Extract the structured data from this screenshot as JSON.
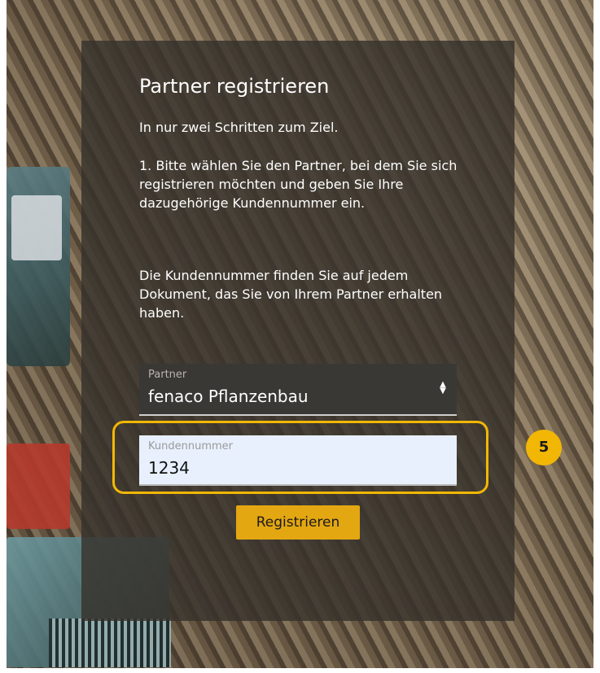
{
  "form": {
    "title": "Partner registrieren",
    "subtitle": "In nur zwei Schritten zum Ziel.",
    "step1": "1. Bitte wählen Sie den Partner, bei dem Sie sich registrieren möchten und geben Sie Ihre dazugehörige Kundennummer ein.",
    "hint": "Die Kundennummer finden Sie auf jedem Dokument, das Sie von Ihrem Partner erhalten haben.",
    "partner": {
      "label": "Partner",
      "value": "fenaco Pflanzenbau",
      "arrow_icon": "sort-arrows-icon"
    },
    "customer_number": {
      "label": "Kundennummer",
      "value": "1234"
    },
    "submit_label": "Registrieren"
  },
  "callout": {
    "number": "5",
    "color": "#f2b705"
  },
  "colors": {
    "panel": "#37322c",
    "button": "#e3a712",
    "input_bg": "#e8f0fe"
  }
}
